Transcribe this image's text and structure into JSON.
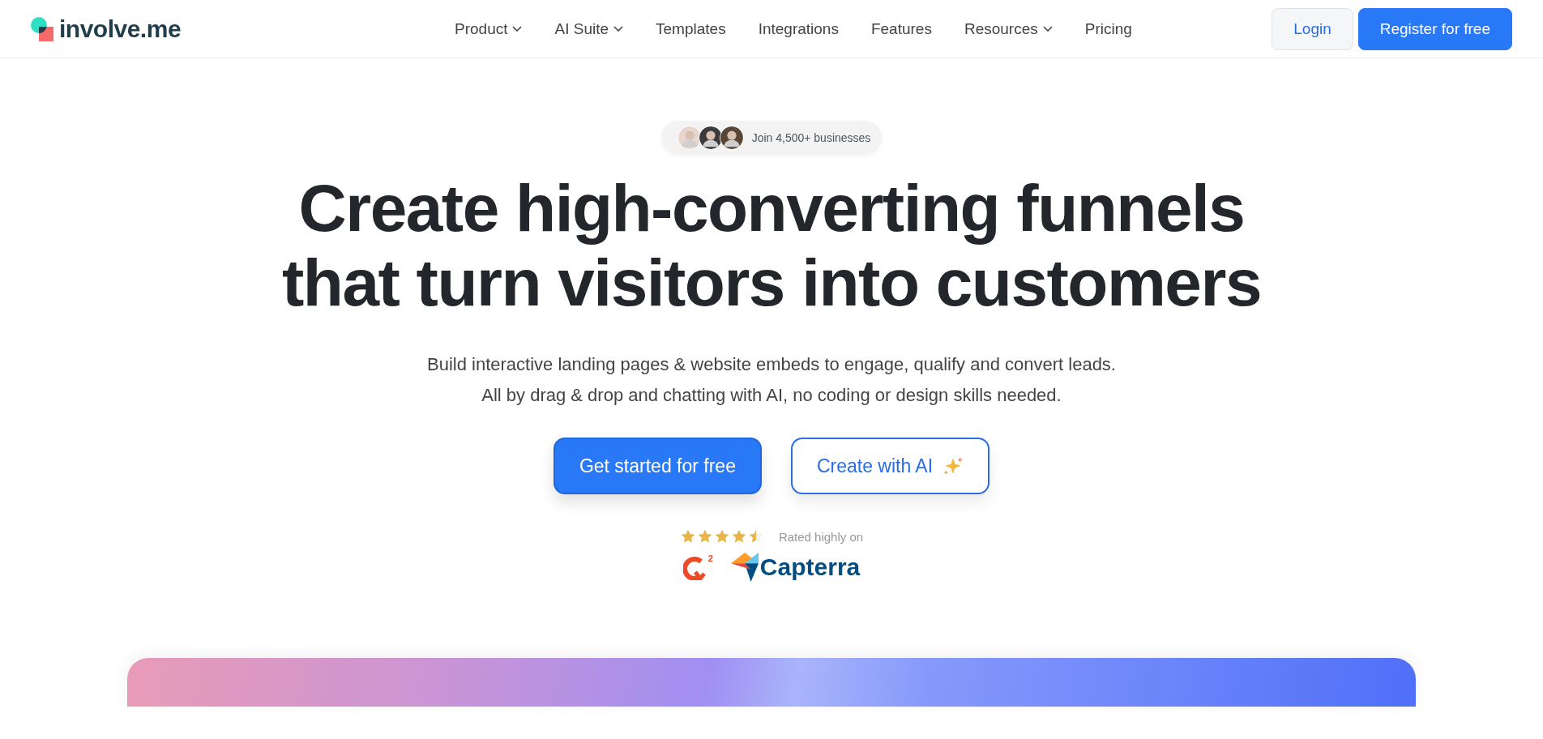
{
  "header": {
    "logo": "involve.me",
    "nav": [
      {
        "label": "Product",
        "dropdown": true
      },
      {
        "label": "AI Suite",
        "dropdown": true
      },
      {
        "label": "Templates",
        "dropdown": false
      },
      {
        "label": "Integrations",
        "dropdown": false
      },
      {
        "label": "Features",
        "dropdown": false
      },
      {
        "label": "Resources",
        "dropdown": true
      },
      {
        "label": "Pricing",
        "dropdown": false
      }
    ],
    "buttons": [
      {
        "label": "Login",
        "kind": "secondary"
      },
      {
        "label": "Register for free",
        "kind": "primary"
      }
    ]
  },
  "hero": {
    "badge": "Join 4,500+ businesses",
    "headline": [
      "Create high-converting funnels",
      "that turn visitors into customers"
    ],
    "subtitle": [
      "Build interactive landing pages & website embeds to engage, qualify and convert leads.",
      "All by drag & drop and chatting with AI, no coding or design skills needed."
    ],
    "buttons": [
      {
        "label": "Get started for free",
        "kind": "primary"
      },
      {
        "label": "Create with AI",
        "kind": "outline"
      }
    ],
    "rating": {
      "stars": 4.5,
      "label": "Rated highly on",
      "logos": [
        {
          "kind": "g2",
          "text": "2"
        },
        {
          "kind": "capterra",
          "text": "Capterra"
        }
      ]
    }
  }
}
